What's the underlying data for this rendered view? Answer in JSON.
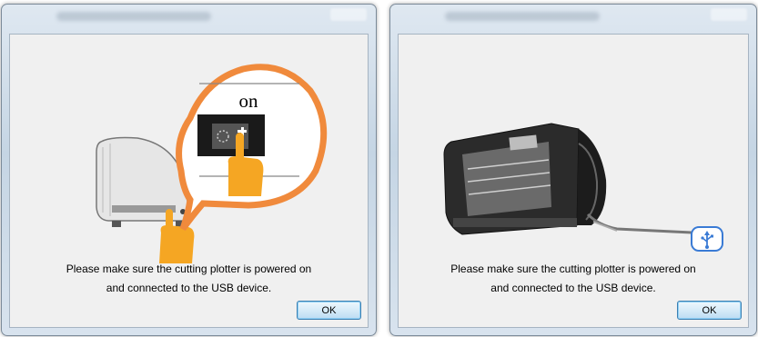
{
  "dialogs": [
    {
      "message_line1": "Please make sure the cutting plotter is powered on",
      "message_line2": "and connected to the USB device.",
      "ok_label": "OK",
      "switch_label": "on"
    },
    {
      "message_line1": "Please make sure the cutting plotter is powered on",
      "message_line2": "and connected to the USB device.",
      "ok_label": "OK"
    }
  ],
  "colors": {
    "callout": "#f08a3c",
    "hand": "#f5a623",
    "usb": "#3a7bd5"
  },
  "icons": [
    "plotter-side-icon",
    "power-switch-icon",
    "hand-pointer-icon",
    "plotter-front-icon",
    "usb-icon"
  ]
}
